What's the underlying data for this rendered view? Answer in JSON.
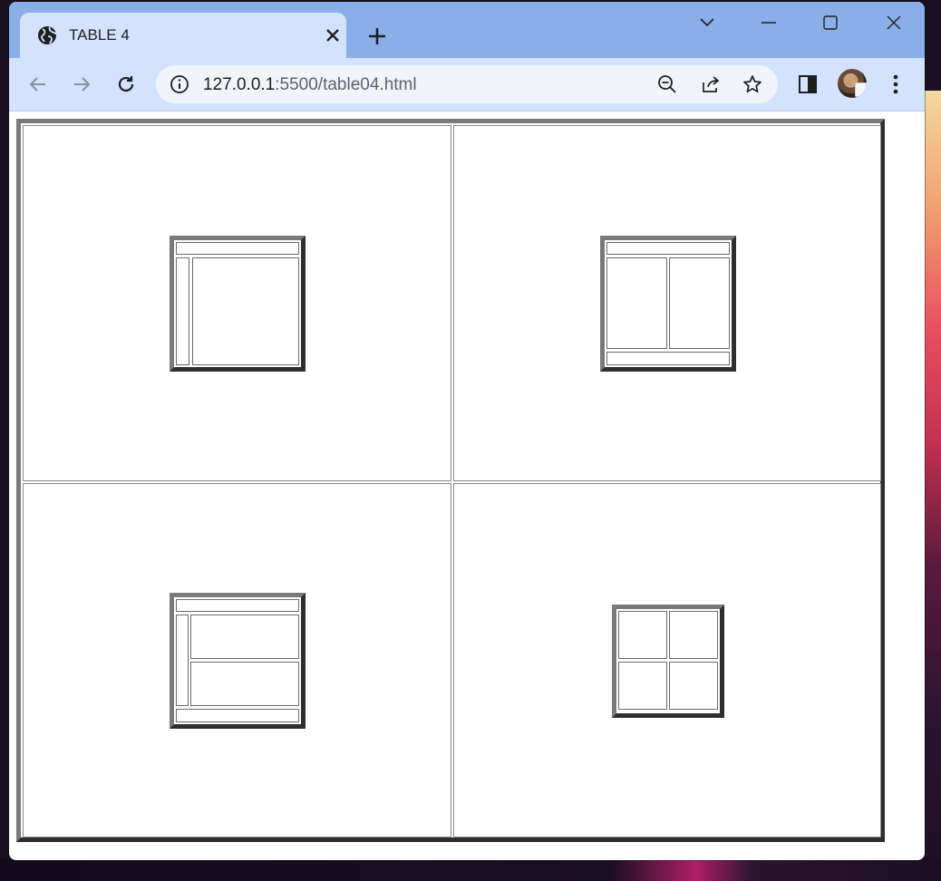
{
  "browser": {
    "tab_title": "TABLE 4",
    "url_host": "127.0.0.1",
    "url_rest": ":5500/table04.html"
  },
  "layouts": [
    {
      "name": "header-sidebar-main"
    },
    {
      "name": "header-two-columns-footer"
    },
    {
      "name": "header-sidebar-two-rows-footer"
    },
    {
      "name": "two-by-two-grid"
    }
  ],
  "colors": {
    "tabstrip": "#8aaee8",
    "toolbar": "#d3e3fd",
    "border_light": "#7a7a7a",
    "border_dark": "#2e2e2e"
  }
}
